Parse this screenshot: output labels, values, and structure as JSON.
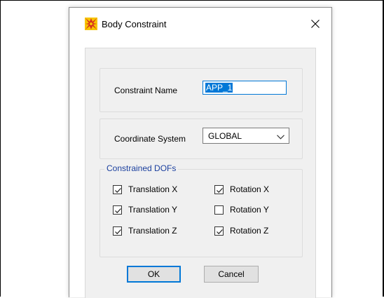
{
  "window": {
    "title": "Body Constraint"
  },
  "constraint_name": {
    "label": "Constraint Name",
    "value": "APP_1"
  },
  "coordinate_system": {
    "label": "Coordinate System",
    "selected": "GLOBAL"
  },
  "dofs": {
    "legend": "Constrained DOFs",
    "items": [
      {
        "label": "Translation X",
        "checked": true
      },
      {
        "label": "Translation Y",
        "checked": true
      },
      {
        "label": "Translation Z",
        "checked": true
      },
      {
        "label": "Rotation X",
        "checked": true
      },
      {
        "label": "Rotation Y",
        "checked": false
      },
      {
        "label": "Rotation Z",
        "checked": true
      }
    ]
  },
  "buttons": {
    "ok": "OK",
    "cancel": "Cancel"
  },
  "colors": {
    "accent": "#0078d7",
    "legend_text": "#1a3f9e",
    "client_bg": "#f0f0f0"
  },
  "icons": {
    "app": "sap-app-icon",
    "close": "close-icon",
    "dropdown": "chevron-down-icon",
    "check": "checkmark-icon"
  }
}
